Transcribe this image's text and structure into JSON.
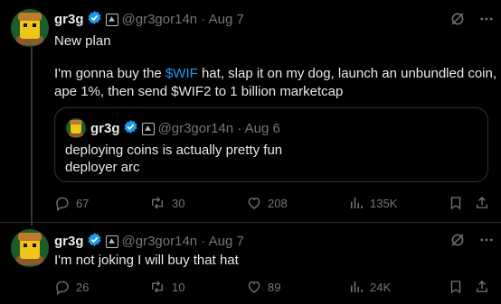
{
  "tweet1": {
    "name": "gr3g",
    "handle_date": "@gr3gor14n · Aug 7",
    "line1": "New plan",
    "line2_pre": "I'm gonna buy the ",
    "line2_link": "$WIF",
    "line2_post": " hat, slap it on my dog, launch an unbundled coin,",
    "line3": "ape 1%, then send $WIF2 to 1 billion marketcap",
    "replies": "67",
    "reposts": "30",
    "likes": "208",
    "views": "135K"
  },
  "quote": {
    "name": "gr3g",
    "handle_date": "@gr3gor14n · Aug 6",
    "line1": "deploying coins is actually pretty fun",
    "line2": "deployer arc"
  },
  "tweet2": {
    "name": "gr3g",
    "handle_date": "@gr3gor14n · Aug 7",
    "text": "I'm not joking I will buy that hat",
    "replies": "26",
    "reposts": "10",
    "likes": "89",
    "views": "24K"
  },
  "colors": {
    "background": "#000000",
    "text": "#e7e9ea",
    "muted": "#71767b",
    "link": "#1d9bf0",
    "verified": "#1d9bf0",
    "border": "#2f3336"
  }
}
